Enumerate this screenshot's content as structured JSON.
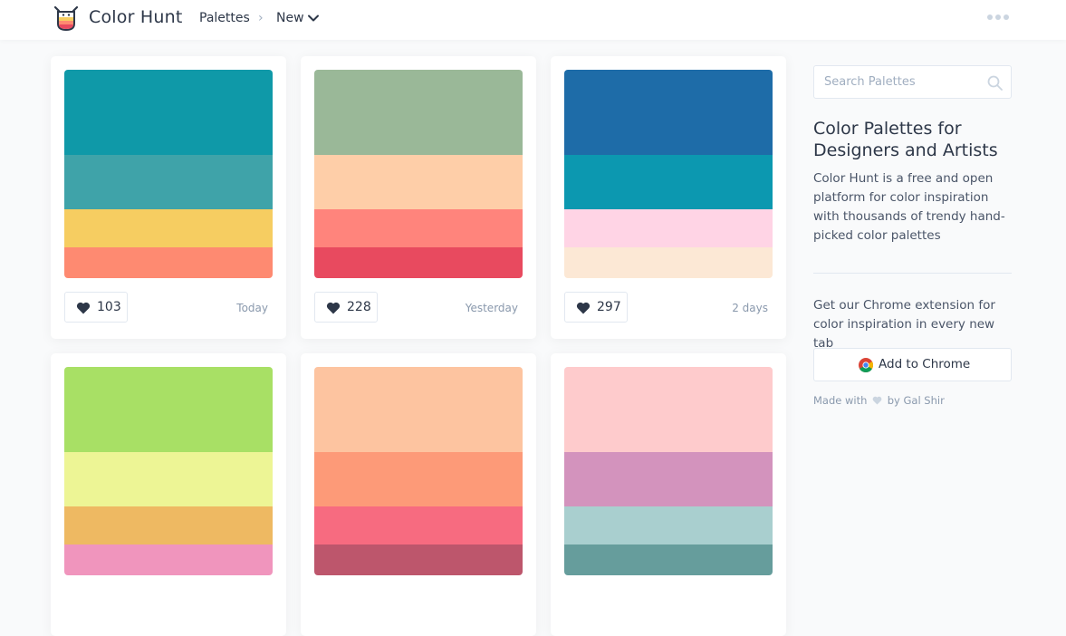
{
  "header": {
    "brand": "Color Hunt",
    "breadcrumb": {
      "palettes": "Palettes",
      "separator": "›",
      "current": "New"
    }
  },
  "palettes": [
    {
      "likes": "103",
      "date": "Today",
      "colors": [
        "#0f99a8",
        "#3fa3a9",
        "#f6cd61",
        "#fe8a71"
      ]
    },
    {
      "likes": "228",
      "date": "Yesterday",
      "colors": [
        "#9ab898",
        "#fecea8",
        "#ff847c",
        "#e84a5f"
      ]
    },
    {
      "likes": "297",
      "date": "2 days",
      "colors": [
        "#1e6ca8",
        "#0c98b0",
        "#ffd4e5",
        "#fce8d5"
      ]
    },
    {
      "colors": [
        "#a8e065",
        "#edf595",
        "#eeb962",
        "#f095bd"
      ]
    },
    {
      "colors": [
        "#fdc4a0",
        "#fd9a78",
        "#f76b80",
        "#bd566c"
      ]
    },
    {
      "colors": [
        "#fecbcc",
        "#d393bd",
        "#a9cfcf",
        "#669d9c"
      ]
    }
  ],
  "sidebar": {
    "search_placeholder": "Search Palettes",
    "title": "Color Palettes for Designers and Artists",
    "description": "Color Hunt is a free and open platform for color inspiration with thousands of trendy hand-picked color palettes",
    "extension_text": "Get our Chrome extension for color inspiration in every new tab",
    "chrome_button": "Add to Chrome",
    "made_with": "Made with",
    "by": "by",
    "author": "Gal Shir"
  },
  "icons": {
    "logo": "color-hunt-logo",
    "chevron": "chevron-down-icon",
    "more": "more-dots-icon",
    "like": "heart-icon",
    "search": "search-icon",
    "chrome": "chrome-icon"
  },
  "theme": {
    "text": "#2d3748",
    "muted": "#8a99ad",
    "border": "#e2e8f0",
    "background": "#f9fafb",
    "heart": "#2d3748",
    "made_heart": "#cbd5e0"
  }
}
